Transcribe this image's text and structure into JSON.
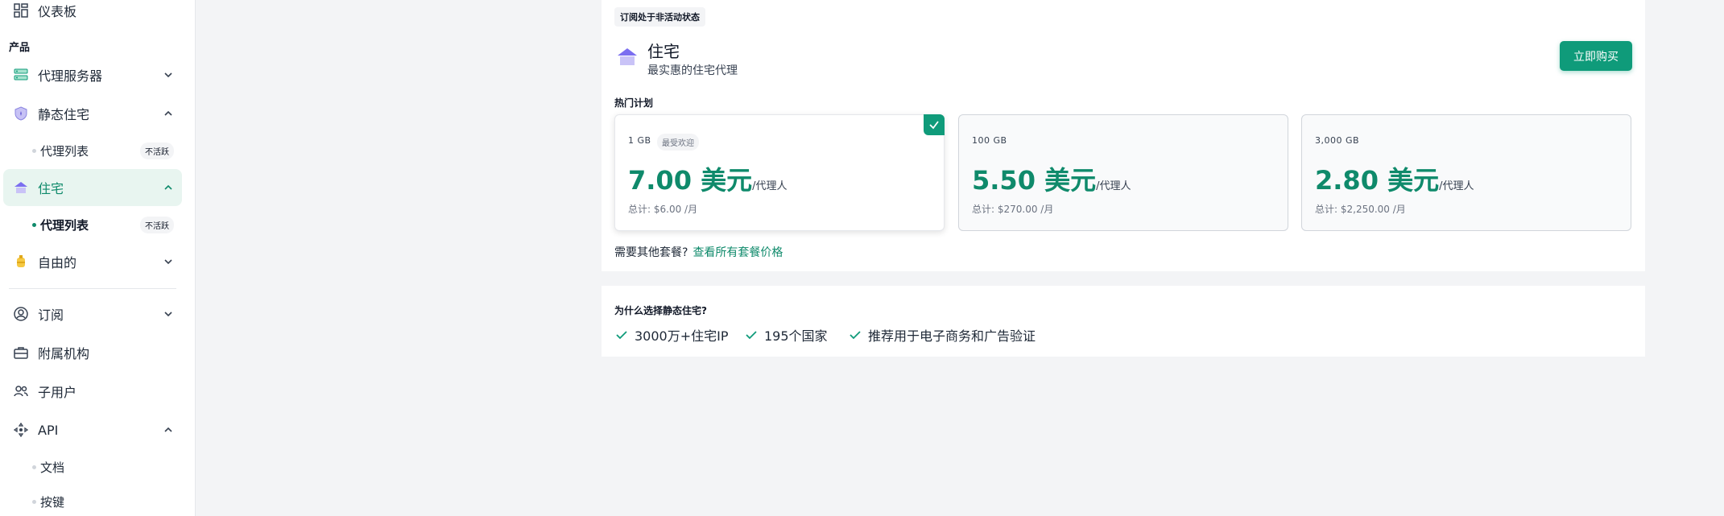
{
  "sidebar": {
    "dashboard": "仪表板",
    "section_products": "产品",
    "proxy_servers": "代理服务器",
    "static_residential": "静态住宅",
    "static_proxy_list": "代理列表",
    "static_proxy_list_badge": "不活跃",
    "residential": "住宅",
    "residential_proxy_list": "代理列表",
    "residential_proxy_list_badge": "不活跃",
    "free": "自由的",
    "subscription": "订阅",
    "affiliate": "附属机构",
    "sub_users": "子用户",
    "api": "API",
    "docs": "文档",
    "keys": "按键"
  },
  "main": {
    "status_badge": "订阅处于非活动状态",
    "product_name": "住宅",
    "product_subtitle": "最实惠的住宅代理",
    "buy_button": "立即购买",
    "plans_label": "热门计划",
    "plans": [
      {
        "size": "1 GB",
        "popular": "最受欢迎",
        "price": "7.00 美元",
        "unit": "/代理人",
        "total": "总计:  $6.00 /月",
        "selected": true
      },
      {
        "size": "100 GB",
        "price": "5.50 美元",
        "unit": "/代理人",
        "total": "总计:  $270.00 /月",
        "selected": false
      },
      {
        "size": "3,000 GB",
        "price": "2.80 美元",
        "unit": "/代理人",
        "total": "总计:  $2,250.00 /月",
        "selected": false
      }
    ],
    "more_text": "需要其他套餐?",
    "more_link": "查看所有套餐价格"
  },
  "why": {
    "title": "为什么选择静态住宅?",
    "features": [
      "3000万+住宅IP",
      "195个国家",
      "推荐用于电子商务和广告验证"
    ]
  },
  "colors": {
    "accent": "#0f8a6b",
    "button": "#0f9b7a",
    "active_bg": "#e8f5f0"
  }
}
